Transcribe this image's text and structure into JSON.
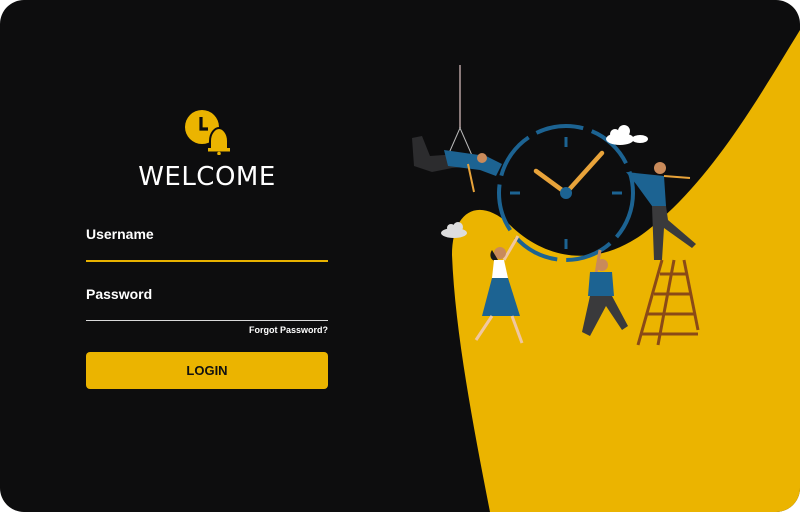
{
  "brand": {
    "logo_icon": "clock-bell-icon",
    "accent": "#ebb400",
    "background": "#0d0d0e"
  },
  "login_form": {
    "title": "WELCOME",
    "username_label": "Username",
    "username_value": "",
    "password_label": "Password",
    "password_value": "",
    "forgot_password": "Forgot Password?",
    "login_button": "LOGIN"
  },
  "illustration": {
    "subject": "team-adjusting-clock",
    "icons": [
      "wall-clock-icon",
      "cloud-icon",
      "ladder-icon"
    ]
  }
}
